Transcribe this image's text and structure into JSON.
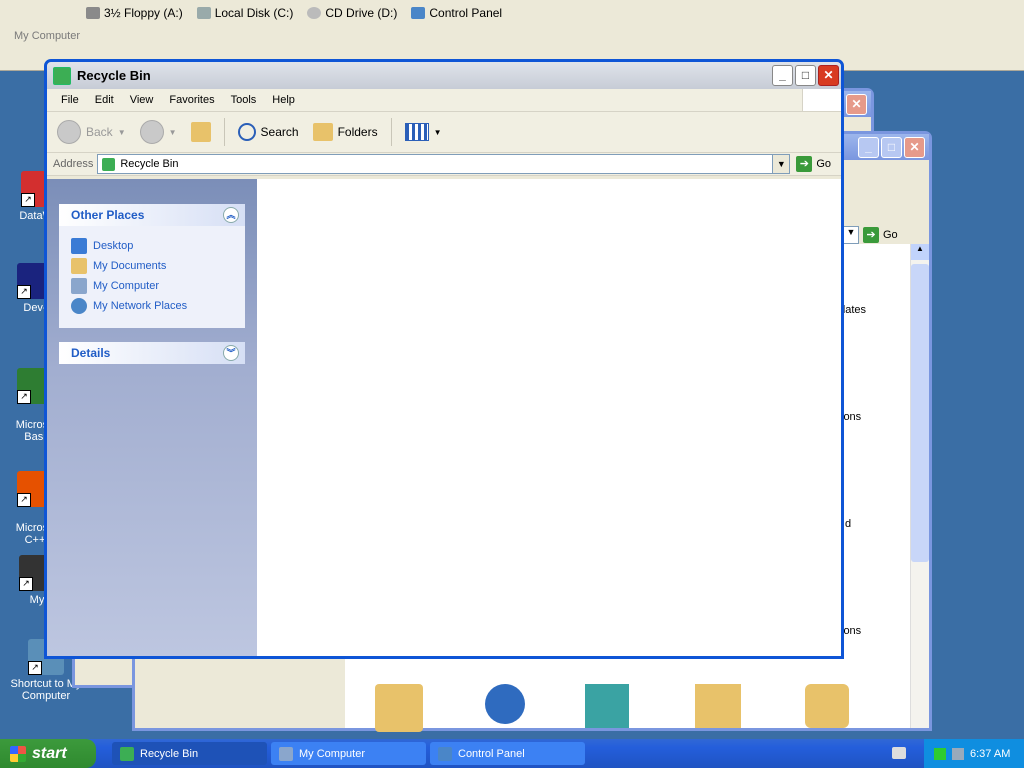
{
  "top_banner": {
    "drives": [
      "3½ Floppy (A:)",
      "Local Disk (C:)",
      "CD Drive (D:)",
      "Control Panel"
    ],
    "caption": "My Computer"
  },
  "desktop_icons": [
    {
      "label": "DataWa",
      "color": "#d32f2f"
    },
    {
      "label": "Dev-",
      "color": "#1a237e"
    },
    {
      "label": "Microso\nBasi",
      "color": "#2e7d32"
    },
    {
      "label": "Microso\nC++",
      "color": "#e65100"
    },
    {
      "label": "My",
      "color": "#333333"
    },
    {
      "label": "Shortcut to My Computer",
      "color": "#5a8fb8"
    }
  ],
  "control_panel_window": {
    "go_label": "Go",
    "items": [
      "pdates",
      "ions",
      "d",
      "ions"
    ]
  },
  "recycle_window": {
    "title": "Recycle Bin",
    "menu": [
      "File",
      "Edit",
      "View",
      "Favorites",
      "Tools",
      "Help"
    ],
    "toolbar": {
      "back": "Back",
      "search": "Search",
      "folders": "Folders"
    },
    "address_label": "Address",
    "address_value": "Recycle Bin",
    "go_label": "Go",
    "other_places_title": "Other Places",
    "other_places": [
      "Desktop",
      "My Documents",
      "My Computer",
      "My Network Places"
    ],
    "details_title": "Details"
  },
  "taskbar": {
    "start_label": "start",
    "tasks": [
      "Recycle Bin",
      "My Computer",
      "Control Panel"
    ],
    "clock": "6:37 AM"
  },
  "colors": {
    "accent": "#0054e3",
    "taskbar": "#245edb",
    "start": "#3c9a3c"
  }
}
